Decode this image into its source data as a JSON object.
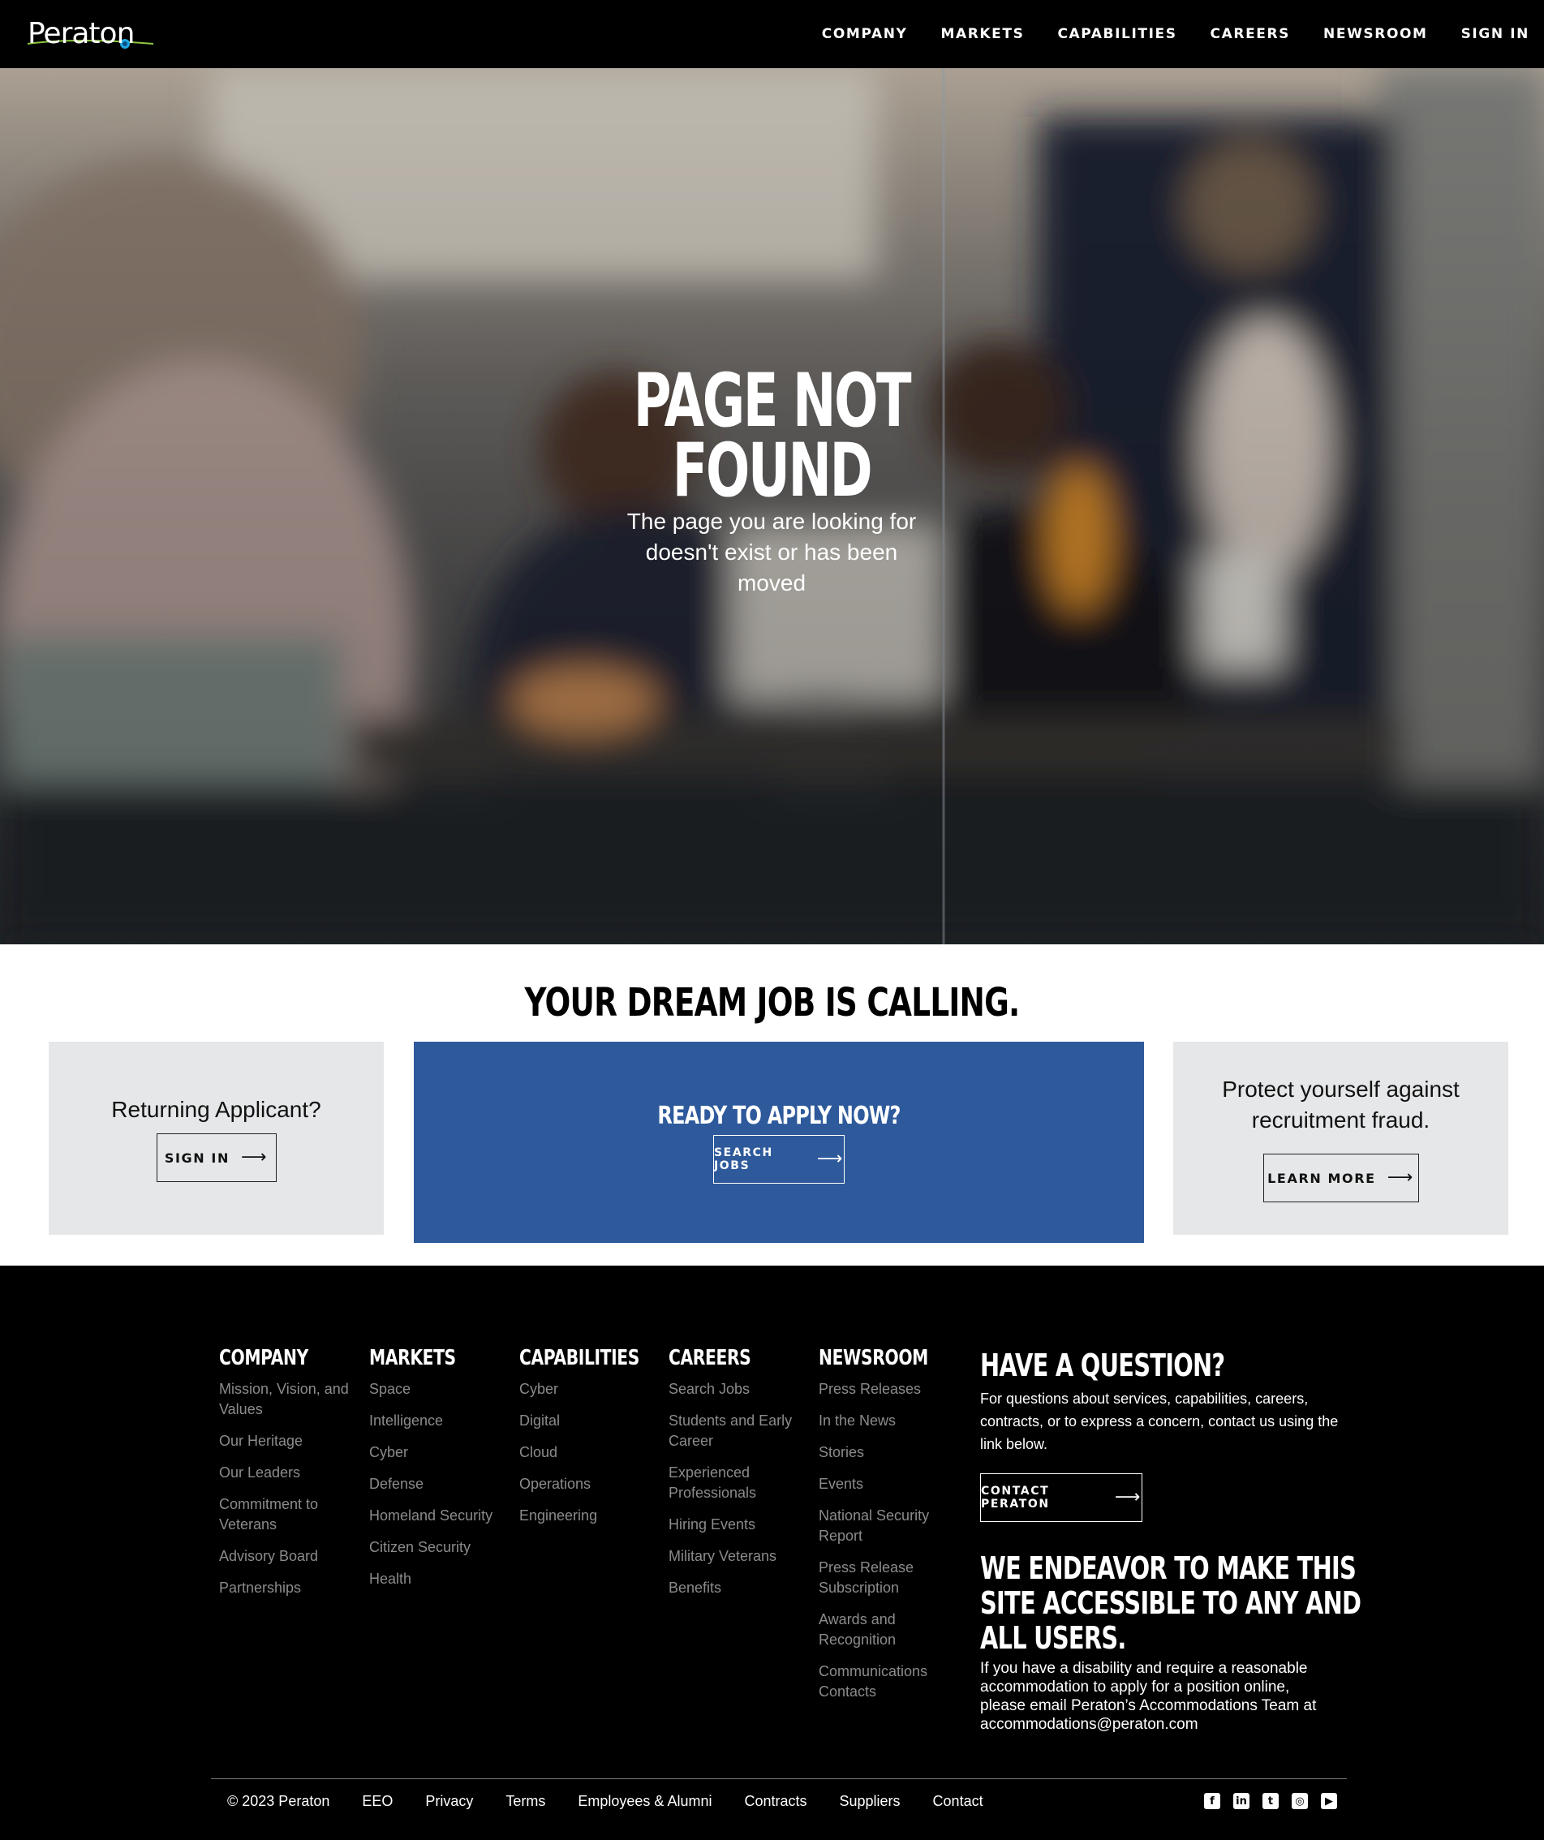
{
  "header": {
    "logo_text": "Peraton",
    "nav": [
      "COMPANY",
      "MARKETS",
      "CAPABILITIES",
      "CAREERS",
      "NEWSROOM",
      "SIGN IN"
    ]
  },
  "hero": {
    "title_line1": "PAGE NOT",
    "title_line2": "FOUND",
    "subtitle": "The page you are looking for doesn't exist or has been moved"
  },
  "dream": {
    "title": "YOUR DREAM JOB IS CALLING.",
    "left": {
      "text": "Returning Applicant?",
      "button": "SIGN IN"
    },
    "middle": {
      "heading": "READY TO APPLY NOW?",
      "button": "SEARCH JOBS"
    },
    "right": {
      "text": "Protect yourself against recruitment fraud.",
      "button": "LEARN MORE"
    }
  },
  "footer": {
    "columns": [
      {
        "title": "COMPANY",
        "links": [
          "Mission, Vision, and Values",
          "Our Heritage",
          "Our Leaders",
          "Commitment to Veterans",
          "Advisory Board",
          "Partnerships"
        ]
      },
      {
        "title": "MARKETS",
        "links": [
          "Space",
          "Intelligence",
          "Cyber",
          "Defense",
          "Homeland Security",
          "Citizen Security",
          "Health"
        ]
      },
      {
        "title": "CAPABILITIES",
        "links": [
          "Cyber",
          "Digital",
          "Cloud",
          "Operations",
          "Engineering"
        ]
      },
      {
        "title": "CAREERS",
        "links": [
          "Search Jobs",
          "Students and Early Career",
          "Experienced Professionals",
          "Hiring Events",
          "Military Veterans",
          "Benefits"
        ]
      },
      {
        "title": "NEWSROOM",
        "links": [
          "Press Releases",
          "In the News",
          "Stories",
          "Events",
          "National Security Report",
          "Press Release Subscription",
          "Awards and Recognition",
          "Communications Contacts"
        ]
      }
    ],
    "question": {
      "title": "HAVE A QUESTION?",
      "text": "For questions about services, capabilities, careers, contracts, or to express a concern, contact us using the link below.",
      "button": "CONTACT PERATON"
    },
    "accessibility": {
      "title_line1": "WE ENDEAVOR TO MAKE THIS",
      "title_line2": "SITE ACCESSIBLE TO ANY AND",
      "title_line3": "ALL USERS.",
      "text": "If you have a disability and require a reasonable accommodation to apply for a position online, please email Peraton’s Accommodations Team at accommodations@peraton.com"
    },
    "bottom_links": [
      "© 2023 Peraton",
      "EEO",
      "Privacy",
      "Terms",
      "Employees & Alumni",
      "Contracts",
      "Suppliers",
      "Contact"
    ],
    "social_icons": [
      "facebook-icon",
      "linkedin-icon",
      "twitter-icon",
      "instagram-icon",
      "youtube-icon"
    ]
  }
}
